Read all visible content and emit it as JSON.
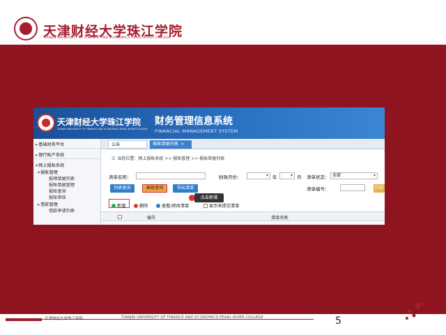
{
  "slide": {
    "school_name": "天津财经大学珠江学院",
    "school_subtitle": "TIANJIN UNIVERSITY OF FINANCE AND ECONOMICS PEARL RIVER COLLEGE",
    "page_number": "5",
    "footer_cn": "天津财经大学珠江学院",
    "footer_en": "TIANJIN UNIVERSITY OF FINANCE AND ECONOMICS PEARL RIVER COLLEGE",
    "colors": {
      "brand_red": "#a51d2d",
      "band_red": "#8e1420",
      "system_blue": "#2a6fc0"
    }
  },
  "system": {
    "school_name": "天津财经大学珠江学院",
    "school_subtitle": "TIANJIN UNIVERSITY OF FINANCE AND ECONOMICS PEARL RIVER COLLEGE",
    "title": "财务管理信息系统",
    "title_en": "FINANCIAL MANAGEMENT SYSTEM"
  },
  "sidebar": {
    "items": [
      {
        "label": "基础财务平台",
        "arrow": "▸"
      },
      {
        "label": "银行账户系统",
        "arrow": "▸"
      },
      {
        "label": "网上报账系统",
        "arrow": "▾"
      },
      {
        "label": "报账管理",
        "arrow": "▾"
      },
      {
        "label": "报销单据列表"
      },
      {
        "label": "报账单据管理"
      },
      {
        "label": "报账查询"
      },
      {
        "label": "报账审核"
      },
      {
        "label": "借款管理",
        "arrow": "▸"
      },
      {
        "label": "借款申请列表"
      }
    ]
  },
  "tabs": {
    "home": "公告",
    "active": "报账单据列表",
    "close_icon": "close-icon"
  },
  "breadcrumb": "当前位置：网上报账系统 >> 报账管理 >> 报账单据列表",
  "filters": {
    "name_label": "清单名称：",
    "year_label": "财政月份：",
    "year_unit": "年",
    "month_unit": "月",
    "status_label": "清单状态：",
    "status_value": "全部",
    "number_label": "清单编号："
  },
  "buttons": {
    "list_query": "列表查询",
    "advanced_query": "高级查询",
    "export": "导出清单",
    "print": "打印"
  },
  "toolbar": {
    "new": "新增",
    "delete": "删除",
    "item3": "查看/修改清单",
    "item4": "显示未提交清单"
  },
  "tooltip": "点击新增",
  "table": {
    "columns": [
      "编号",
      "清单名称"
    ]
  }
}
